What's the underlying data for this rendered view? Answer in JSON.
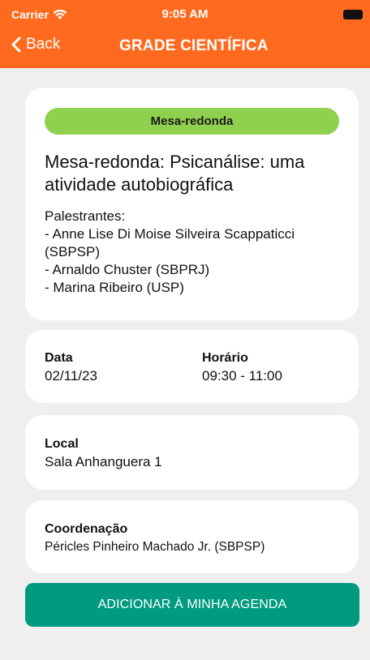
{
  "status_bar": {
    "carrier": "Carrier",
    "time": "9:05 AM"
  },
  "nav": {
    "back_label": "Back",
    "title": "GRADE CIENTÍFICA"
  },
  "event": {
    "category": "Mesa-redonda",
    "title": "Mesa-redonda: Psicanálise: uma atividade autobiográfica",
    "speakers_label": "Palestrantes:",
    "speakers": [
      "- Anne Lise Di Moise Silveira Scappaticci (SBPSP)",
      "- Arnaldo Chuster (SBPRJ)",
      "- Marina Ribeiro (USP)"
    ]
  },
  "schedule": {
    "date_label": "Data",
    "date_value": "02/11/23",
    "time_label": "Horário",
    "time_value": "09:30 - 11:00"
  },
  "location": {
    "label": "Local",
    "value": "Sala Anhanguera 1"
  },
  "coordination": {
    "label": "Coordenação",
    "value": "Péricles Pinheiro Machado Jr. (SBPSP)"
  },
  "actions": {
    "add_to_agenda": "ADICIONAR À MINHA AGENDA"
  },
  "colors": {
    "header": "#ff6a1f",
    "badge": "#8fd14f",
    "button": "#009a7f",
    "background": "#efefef"
  },
  "icons": {
    "wifi": "wifi-icon",
    "battery": "battery-icon",
    "back": "chevron-left-icon"
  }
}
